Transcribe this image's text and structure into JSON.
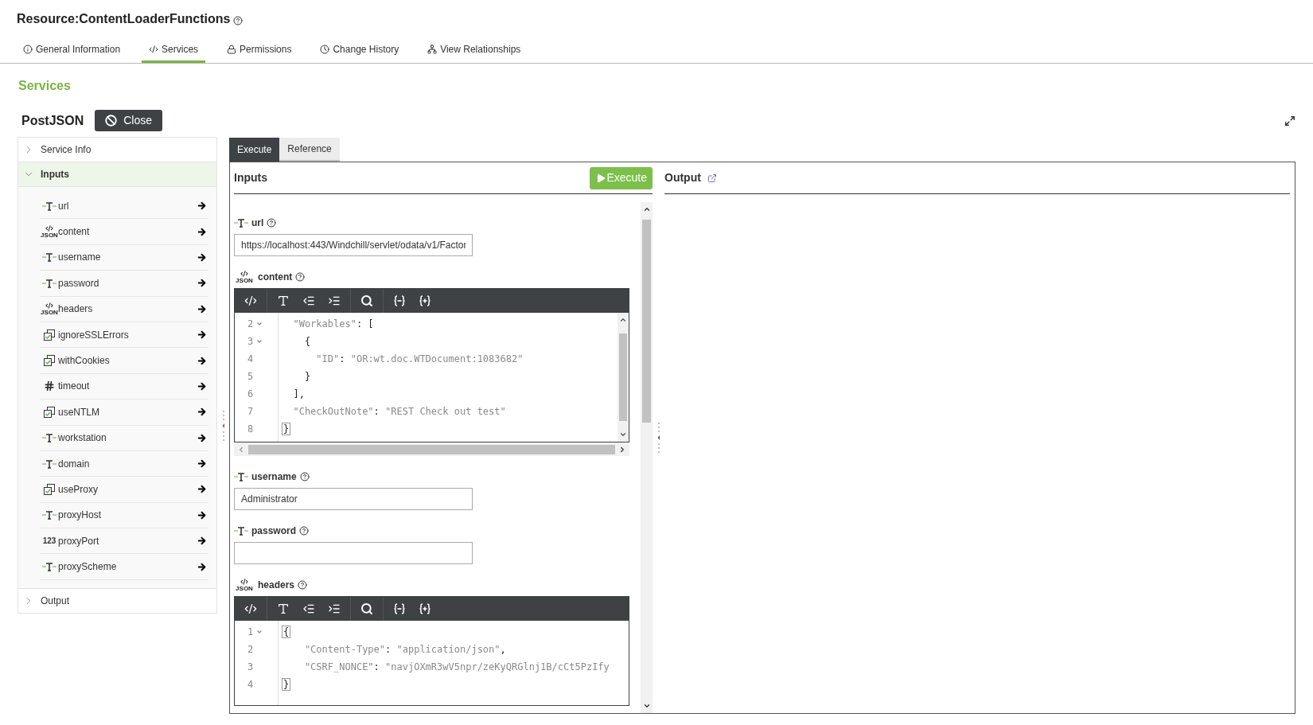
{
  "title": "Resource:ContentLoaderFunctions",
  "tabs": [
    {
      "label": "General Information",
      "selected": false
    },
    {
      "label": "Services",
      "selected": true
    },
    {
      "label": "Permissions",
      "selected": false
    },
    {
      "label": "Change History",
      "selected": false
    },
    {
      "label": "View Relationships",
      "selected": false
    }
  ],
  "section_heading": "Services",
  "service": {
    "name": "PostJSON",
    "close_label": "Close"
  },
  "sidebar": {
    "sections": [
      {
        "label": "Service Info",
        "expanded": false
      },
      {
        "label": "Inputs",
        "expanded": true,
        "items": [
          {
            "name": "url",
            "kind": "string"
          },
          {
            "name": "content",
            "kind": "json",
            "type_badge": "JSON"
          },
          {
            "name": "username",
            "kind": "string"
          },
          {
            "name": "password",
            "kind": "string"
          },
          {
            "name": "headers",
            "kind": "json",
            "type_badge": "JSON"
          },
          {
            "name": "ignoreSSLErrors",
            "kind": "boolean"
          },
          {
            "name": "withCookies",
            "kind": "boolean"
          },
          {
            "name": "timeout",
            "kind": "number"
          },
          {
            "name": "useNTLM",
            "kind": "boolean"
          },
          {
            "name": "workstation",
            "kind": "string"
          },
          {
            "name": "domain",
            "kind": "string"
          },
          {
            "name": "useProxy",
            "kind": "boolean"
          },
          {
            "name": "proxyHost",
            "kind": "string"
          },
          {
            "name": "proxyPort",
            "kind": "integer",
            "type_badge": "123"
          },
          {
            "name": "proxyScheme",
            "kind": "string"
          }
        ]
      },
      {
        "label": "Output",
        "expanded": false
      }
    ]
  },
  "panel_tabs": [
    {
      "label": "Execute",
      "selected": true
    },
    {
      "label": "Reference",
      "selected": false
    }
  ],
  "inputs": {
    "heading": "Inputs",
    "execute_label": "Execute",
    "fields": [
      {
        "label": "url",
        "kind": "text",
        "value": "https://localhost:443/Windchill/servlet/odata/v1/Factor"
      },
      {
        "label": "content",
        "kind": "editor",
        "type_badge": "JSON",
        "lines": [
          {
            "number": "2",
            "fold": true,
            "tokens": [
              {
                "kind": "string",
                "text": "  \"Workables\""
              },
              {
                "kind": "punct",
                "text": ": ["
              }
            ]
          },
          {
            "number": "3",
            "fold": true,
            "tokens": [
              {
                "kind": "punct",
                "text": "    {"
              }
            ]
          },
          {
            "number": "4",
            "fold": false,
            "tokens": [
              {
                "kind": "string",
                "text": "      \"ID\""
              },
              {
                "kind": "punct",
                "text": ": "
              },
              {
                "kind": "string",
                "text": "\"OR:wt.doc.WTDocument:1083682\""
              }
            ]
          },
          {
            "number": "5",
            "fold": false,
            "tokens": [
              {
                "kind": "punct",
                "text": "    }"
              }
            ]
          },
          {
            "number": "6",
            "fold": false,
            "tokens": [
              {
                "kind": "punct",
                "text": "  ],"
              }
            ]
          },
          {
            "number": "7",
            "fold": false,
            "tokens": [
              {
                "kind": "string",
                "text": "  \"CheckOutNote\""
              },
              {
                "kind": "punct",
                "text": ": "
              },
              {
                "kind": "string",
                "text": "\"REST Check out test\""
              }
            ]
          },
          {
            "number": "8",
            "fold": false,
            "tokens": [
              {
                "kind": "match",
                "text": "}"
              }
            ]
          }
        ]
      },
      {
        "label": "username",
        "kind": "text",
        "value": "Administrator"
      },
      {
        "label": "password",
        "kind": "text"
      },
      {
        "label": "headers",
        "kind": "editor",
        "type_badge": "JSON",
        "lines": [
          {
            "number": "1",
            "fold": true,
            "tokens": [
              {
                "kind": "match",
                "text": "{"
              }
            ]
          },
          {
            "number": "2",
            "fold": false,
            "tokens": [
              {
                "kind": "string",
                "text": "    \"Content-Type\""
              },
              {
                "kind": "punct",
                "text": ": "
              },
              {
                "kind": "string",
                "text": "\"application/json\""
              },
              {
                "kind": "punct",
                "text": ","
              }
            ]
          },
          {
            "number": "3",
            "fold": false,
            "tokens": [
              {
                "kind": "string",
                "text": "    \"CSRF_NONCE\""
              },
              {
                "kind": "punct",
                "text": ": "
              },
              {
                "kind": "string",
                "text": "\"navjOXmR3wV5npr/zeKyQRGlnj1B/cCt5PzIfy"
              }
            ]
          },
          {
            "number": "4",
            "fold": false,
            "tokens": [
              {
                "kind": "match",
                "text": "}"
              }
            ]
          }
        ]
      }
    ]
  },
  "output": {
    "heading": "Output"
  }
}
